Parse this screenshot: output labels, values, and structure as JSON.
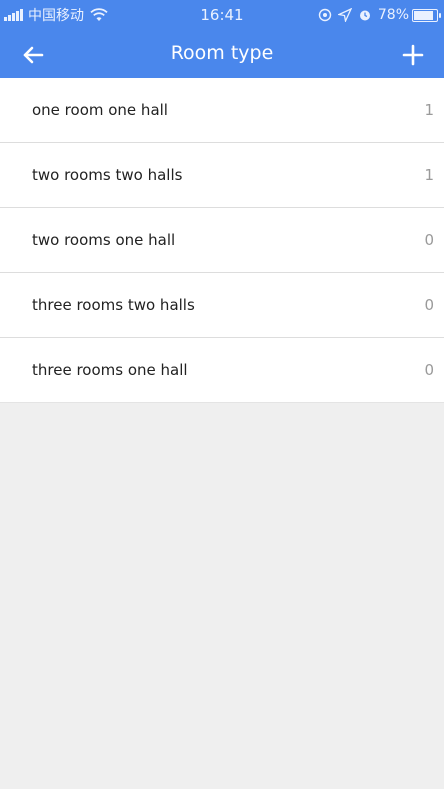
{
  "status_bar": {
    "carrier": "中国移动",
    "time": "16:41",
    "battery_percent": "78%",
    "battery_level": 0.78,
    "icons": [
      "signal-icon",
      "wifi-icon",
      "location-lock-icon",
      "location-arrow-icon",
      "alarm-icon",
      "battery-icon"
    ]
  },
  "navbar": {
    "title": "Room type",
    "back_icon": "arrow-left-icon",
    "add_icon": "plus-icon"
  },
  "room_types": [
    {
      "name": "one room one hall",
      "count": "1"
    },
    {
      "name": "two rooms two halls",
      "count": "1"
    },
    {
      "name": "two rooms one hall",
      "count": "0"
    },
    {
      "name": "three rooms two halls",
      "count": "0"
    },
    {
      "name": "three rooms one hall",
      "count": "0"
    }
  ],
  "colors": {
    "header": "#4a87ec",
    "background": "#efefef",
    "divider": "#dddddd",
    "count_text": "#9a9a9a"
  }
}
